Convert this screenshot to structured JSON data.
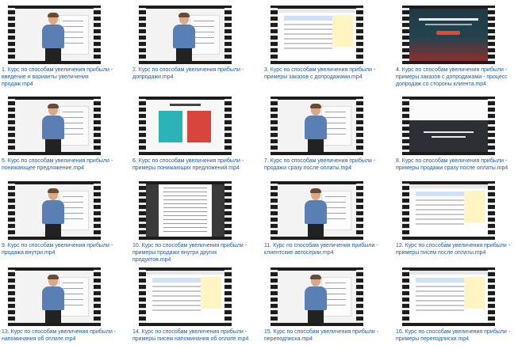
{
  "files": [
    {
      "caption": "1. Курс по способам увеличения прибыли - введение и варианты увеличения продаж.mp4",
      "thumb": "lecture"
    },
    {
      "caption": "2. Курс по способам увеличения прибыли - допродажи.mp4",
      "thumb": "lecture"
    },
    {
      "caption": "3. Курс по способам увеличения прибыли - примеры заказов с допродажами.mp4",
      "thumb": "screen"
    },
    {
      "caption": "4. Курс по способам увеличения прибыли - примеры заказов с допродажами - процесс допродаж со стороны клиента.mp4",
      "thumb": "dark"
    },
    {
      "caption": "5. Курс по способам увеличения прибыли - понижающее предложение.mp4",
      "thumb": "lecture"
    },
    {
      "caption": "6. Курс по способам увеличения прибыли - примеры понижающих предложений.mp4",
      "thumb": "cards"
    },
    {
      "caption": "7. Курс по способам увеличения прибыли - продажи сразу после оплаты.mp4",
      "thumb": "lecture"
    },
    {
      "caption": "8. Курс по способам увеличения прибыли - примеры продажи сразу после оплаты.mp4",
      "thumb": "slide"
    },
    {
      "caption": "9. Курс по способам увеличения прибыли - продажа внутри.mp4",
      "thumb": "lecture"
    },
    {
      "caption": "10. Курс по способам увеличения прибыли - примеры продажи внутри других продуктов.mp4",
      "thumb": "pdf"
    },
    {
      "caption": "11. Курс по способам увеличения прибыли - клиентские автосерии.mp4",
      "thumb": "lecture"
    },
    {
      "caption": "12. Курс по способам увеличения прибыли - примеры писем после оплаты.mp4",
      "thumb": "screen"
    },
    {
      "caption": "13. Курс по способам увеличения прибыли - напоминания об оплате.mp4",
      "thumb": "lecture"
    },
    {
      "caption": "14. Курс по способам увеличения прибыли - примеры писем напоминания об оплате.mp4",
      "thumb": "screen"
    },
    {
      "caption": "15. Курс по способам увеличения прибыли - переподписка.mp4",
      "thumb": "lecture"
    },
    {
      "caption": "16. Курс по способам увеличения прибыли - примеры переподписки.mp4",
      "thumb": "screen"
    }
  ]
}
